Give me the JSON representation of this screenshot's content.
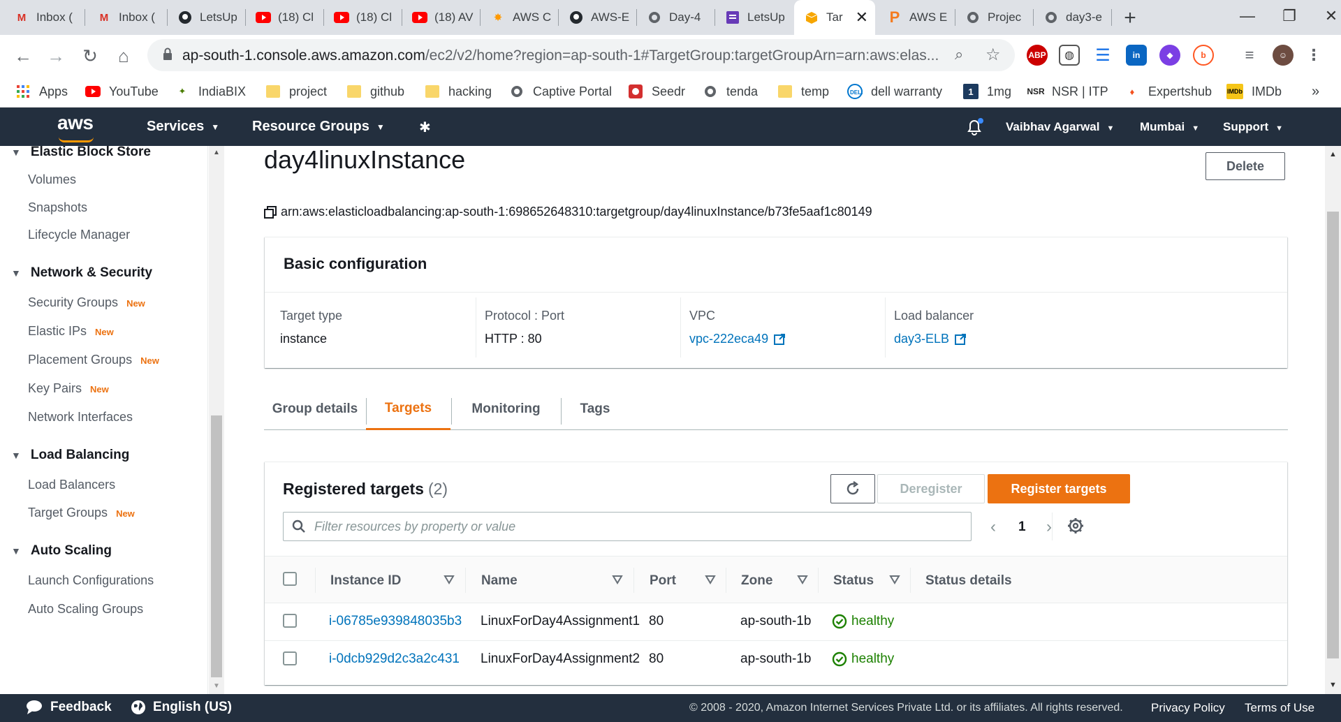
{
  "browser": {
    "tabs": [
      {
        "icon": "gmail-icon",
        "label": "Inbox ("
      },
      {
        "icon": "gmail-icon",
        "label": "Inbox ("
      },
      {
        "icon": "github-icon",
        "label": "LetsUp"
      },
      {
        "icon": "youtube-icon",
        "label": "(18) Cl"
      },
      {
        "icon": "youtube-icon",
        "label": "(18) Cl"
      },
      {
        "icon": "youtube-icon",
        "label": "(18) AV"
      },
      {
        "icon": "aws-icon",
        "label": "AWS C"
      },
      {
        "icon": "github-icon",
        "label": "AWS-E"
      },
      {
        "icon": "globe-icon",
        "label": "Day-4"
      },
      {
        "icon": "doc-icon",
        "label": "LetsUp"
      },
      {
        "icon": "aws-box-icon",
        "label": "Tar",
        "active": true
      },
      {
        "icon": "p-icon",
        "label": "AWS E"
      },
      {
        "icon": "globe-icon",
        "label": "Projec"
      },
      {
        "icon": "globe-icon",
        "label": "day3-e"
      }
    ],
    "new_tab": "+",
    "url_host": "ap-south-1.console.aws.amazon.com",
    "url_path": "/ec2/v2/home?region=ap-south-1#TargetGroup:targetGroupArn=arn:aws:elas...",
    "bookmarks": [
      {
        "icon": "apps-icon",
        "label": "Apps"
      },
      {
        "icon": "youtube-icon",
        "label": "YouTube"
      },
      {
        "icon": "indiabix-icon",
        "label": "IndiaBIX"
      },
      {
        "icon": "folder-icon",
        "label": "project"
      },
      {
        "icon": "folder-icon",
        "label": "github"
      },
      {
        "icon": "folder-icon",
        "label": "hacking"
      },
      {
        "icon": "globe-icon",
        "label": "Captive Portal"
      },
      {
        "icon": "seedr-icon",
        "label": "Seedr"
      },
      {
        "icon": "globe-icon",
        "label": "tenda"
      },
      {
        "icon": "folder-icon",
        "label": "temp"
      },
      {
        "icon": "dell-icon",
        "label": "dell warranty"
      },
      {
        "icon": "1mg-icon",
        "label": "1mg"
      },
      {
        "icon": "nsr-icon",
        "label": "NSR | ITP"
      },
      {
        "icon": "expertshub-icon",
        "label": "Expertshub"
      },
      {
        "icon": "imdb-icon",
        "label": "IMDb"
      }
    ],
    "bookmarks_more": "»",
    "extensions": {
      "abp": "ABP"
    }
  },
  "aws": {
    "logo": "aws",
    "services": "Services",
    "resource_groups": "Resource Groups",
    "user": "Vaibhav Agarwal",
    "region": "Mumbai",
    "support": "Support"
  },
  "sidebar": {
    "sections": [
      {
        "title": "Elastic Block Store",
        "items": [
          {
            "label": "Volumes"
          },
          {
            "label": "Snapshots"
          },
          {
            "label": "Lifecycle Manager"
          }
        ]
      },
      {
        "title": "Network & Security",
        "items": [
          {
            "label": "Security Groups",
            "badge": "New"
          },
          {
            "label": "Elastic IPs",
            "badge": "New"
          },
          {
            "label": "Placement Groups",
            "badge": "New"
          },
          {
            "label": "Key Pairs",
            "badge": "New"
          },
          {
            "label": "Network Interfaces"
          }
        ]
      },
      {
        "title": "Load Balancing",
        "items": [
          {
            "label": "Load Balancers"
          },
          {
            "label": "Target Groups",
            "badge": "New"
          }
        ]
      },
      {
        "title": "Auto Scaling",
        "items": [
          {
            "label": "Launch Configurations"
          },
          {
            "label": "Auto Scaling Groups"
          }
        ]
      }
    ]
  },
  "main": {
    "title": "day4linuxInstance",
    "delete_label": "Delete",
    "arn": "arn:aws:elasticloadbalancing:ap-south-1:698652648310:targetgroup/day4linuxInstance/b73fe5aaf1c80149",
    "basic": {
      "title": "Basic configuration",
      "target_type_label": "Target type",
      "target_type": "instance",
      "protocol_label": "Protocol : Port",
      "protocol": "HTTP : 80",
      "vpc_label": "VPC",
      "vpc": "vpc-222eca49",
      "lb_label": "Load balancer",
      "lb": "day3-ELB"
    },
    "tabs": [
      {
        "label": "Group details"
      },
      {
        "label": "Targets",
        "active": true
      },
      {
        "label": "Monitoring"
      },
      {
        "label": "Tags"
      }
    ],
    "targets": {
      "title": "Registered targets",
      "count": "(2)",
      "deregister_label": "Deregister",
      "register_label": "Register targets",
      "filter_placeholder": "Filter resources by property or value",
      "page": "1",
      "columns": [
        "Instance ID",
        "Name",
        "Port",
        "Zone",
        "Status",
        "Status details"
      ],
      "rows": [
        {
          "instance_id": "i-06785e939848035b3",
          "name": "LinuxForDay4Assignment1",
          "port": "80",
          "zone": "ap-south-1b",
          "status": "healthy",
          "details": ""
        },
        {
          "instance_id": "i-0dcb929d2c3a2c431",
          "name": "LinuxForDay4Assignment2",
          "port": "80",
          "zone": "ap-south-1b",
          "status": "healthy",
          "details": ""
        }
      ]
    }
  },
  "footer": {
    "feedback": "Feedback",
    "language": "English (US)",
    "copyright": "© 2008 - 2020, Amazon Internet Services Private Ltd. or its affiliates. All rights reserved.",
    "privacy": "Privacy Policy",
    "terms": "Terms of Use"
  },
  "colors": {
    "aws_nav": "#232f3e",
    "accent_orange": "#ec7211",
    "link_blue": "#0073bb",
    "healthy_green": "#1d8102"
  }
}
